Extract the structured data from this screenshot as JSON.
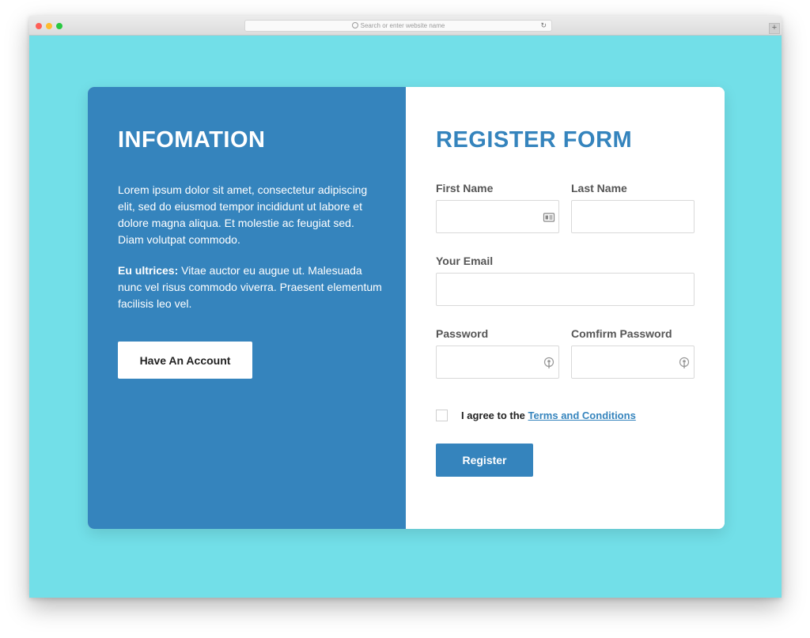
{
  "browser": {
    "url_placeholder": "Search or enter website name",
    "newtab_label": "+"
  },
  "info": {
    "title": "INFOMATION",
    "paragraph1": "Lorem ipsum dolor sit amet, consectetur adipiscing elit, sed do eiusmod tempor incididunt ut labore et dolore magna aliqua. Et molestie ac feugiat sed. Diam volutpat commodo.",
    "paragraph2_strong": "Eu ultrices:",
    "paragraph2_text": " Vitae auctor eu augue ut. Malesuada nunc vel risus commodo viverra. Praesent elementum facilisis leo vel.",
    "have_account_label": "Have An Account"
  },
  "form": {
    "title": "REGISTER FORM",
    "first_name_label": "First Name",
    "last_name_label": "Last Name",
    "email_label": "Your Email",
    "password_label": "Password",
    "confirm_password_label": "Comfirm Password",
    "agree_text": "I agree to the ",
    "terms_link": "Terms and Conditions",
    "register_label": "Register"
  },
  "colors": {
    "background": "#72dfe8",
    "accent": "#3584bd"
  },
  "icons": {
    "first_name_field": "contact-card-icon",
    "password_field": "key-icon",
    "confirm_password_field": "key-icon"
  }
}
